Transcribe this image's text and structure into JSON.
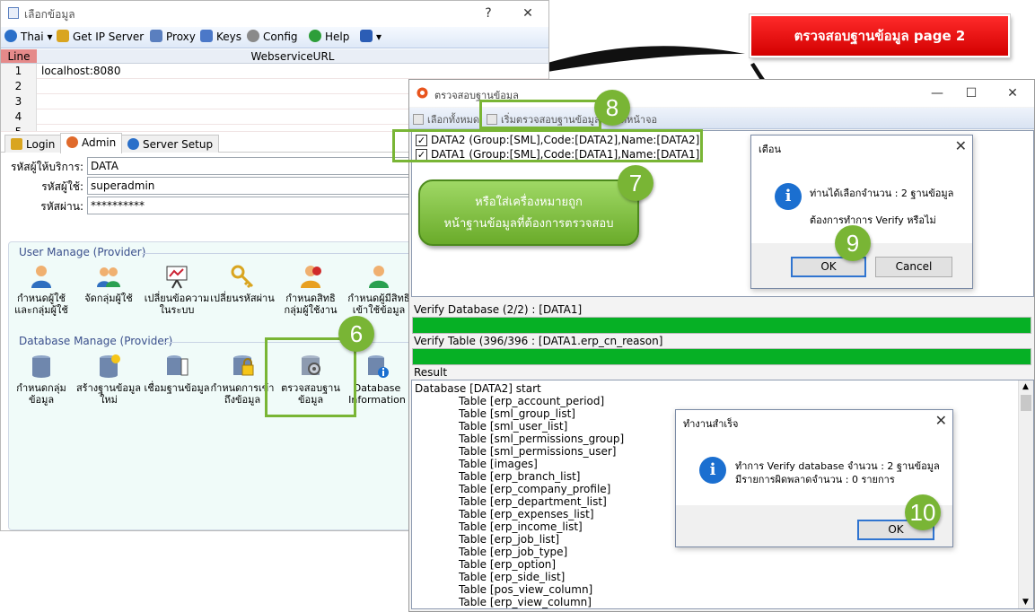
{
  "banner": {
    "text": "ตรวจสอบฐานข้อมูล page 2"
  },
  "win1": {
    "title": "เลือกข้อมูล",
    "help_glyph": "?",
    "close_glyph": "✕",
    "menu": [
      {
        "label": "Thai",
        "icon": "globe-icon",
        "color": "#2a6fc9"
      },
      {
        "label": "Get IP Server",
        "icon": "key-icon",
        "color": "#d9a520"
      },
      {
        "label": "Proxy",
        "icon": "proxy-icon",
        "color": "#5a7fbf"
      },
      {
        "label": "Keys",
        "icon": "users-icon",
        "color": "#4b78c8"
      },
      {
        "label": "Config",
        "icon": "gear-icon",
        "color": "#6a6a6a"
      },
      {
        "label": "Help",
        "icon": "help-icon",
        "color": "#2e9e3a"
      }
    ],
    "grid": {
      "col_line": "Line",
      "col_url": "WebserviceURL",
      "rows": [
        {
          "n": "1",
          "v": "localhost:8080"
        },
        {
          "n": "2",
          "v": ""
        },
        {
          "n": "3",
          "v": ""
        },
        {
          "n": "4",
          "v": ""
        },
        {
          "n": "5",
          "v": ""
        }
      ]
    },
    "tabs": [
      "Login",
      "Admin",
      "Server Setup"
    ],
    "fields": [
      {
        "label": "รหัสผู้ให้บริการ:",
        "value": "DATA"
      },
      {
        "label": "รหัสผู้ใช้:",
        "value": "superadmin"
      },
      {
        "label": "รหัสผ่าน:",
        "value": "**********"
      }
    ],
    "group_user": "User Manage (Provider)",
    "group_db": "Database Manage (Provider)",
    "user_icons": [
      {
        "l1": "กำหนดผู้ใช้",
        "l2": "และกลุ่มผู้ใช้",
        "icon": "user-icon"
      },
      {
        "l1": "จัดกลุ่มผู้ใช้",
        "l2": "",
        "icon": "user-group-icon"
      },
      {
        "l1": "เปลี่ยนข้อความ",
        "l2": "ในระบบ",
        "icon": "presentation-icon"
      },
      {
        "l1": "เปลี่ยนรหัสผ่าน",
        "l2": "",
        "icon": "keys-icon"
      },
      {
        "l1": "กำหนดสิทธิ",
        "l2": "กลุ่มผู้ใช้งาน",
        "icon": "group-permission-icon"
      },
      {
        "l1": "กำหนดผู้มีสิทธิ",
        "l2": "เข้าใช้ข้อมูล",
        "icon": "user-access-icon"
      }
    ],
    "db_icons": [
      {
        "l1": "กำหนดกลุ่ม",
        "l2": "ข้อมูล",
        "icon": "database-icon"
      },
      {
        "l1": "สร้างฐานข้อมูล",
        "l2": "ใหม่",
        "icon": "new-database-icon"
      },
      {
        "l1": "เชื่อมฐานข้อมูล",
        "l2": "",
        "icon": "connect-database-icon"
      },
      {
        "l1": "กำหนดการเข้า",
        "l2": "ถึงข้อมูล",
        "icon": "lock-database-icon"
      },
      {
        "l1": "ตรวจสอบฐาน",
        "l2": "ข้อมูล",
        "icon": "verify-database-icon"
      },
      {
        "l1": "Database",
        "l2": "Information",
        "icon": "database-info-icon"
      }
    ]
  },
  "win2": {
    "title": "ตรวจสอบฐานข้อมูล",
    "min_glyph": "—",
    "max_glyph": "☐",
    "close_glyph": "✕",
    "toolbar": [
      "เลือกทั้งหมด",
      "เริ่มตรวจสอบฐานข้อมูล",
      "ปิดหน้าจอ"
    ],
    "databases": [
      "DATA2 (Group:[SML],Code:[DATA2],Name:[DATA2]",
      "DATA1 (Group:[SML],Code:[DATA1],Name:[DATA1]"
    ],
    "verify_db": "Verify Database (2/2) : [DATA1]",
    "verify_db_progress": 1.0,
    "verify_table": "Verify Table (396/396 : [DATA1.erp_cn_reason]",
    "verify_table_progress": 1.0,
    "result_label": "Result",
    "result_lines": [
      "Database [DATA2] start",
      "Table [erp_account_period]",
      "Table [sml_group_list]",
      "Table [sml_user_list]",
      "Table [sml_permissions_group]",
      "Table [sml_permissions_user]",
      "Table [images]",
      "Table [erp_branch_list]",
      "Table [erp_company_profile]",
      "Table [erp_department_list]",
      "Table [erp_expenses_list]",
      "Table [erp_income_list]",
      "Table [erp_job_list]",
      "Table [erp_job_type]",
      "Table [erp_option]",
      "Table [erp_side_list]",
      "Table [pos_view_column]",
      "Table [erp_view_column]"
    ]
  },
  "dlg_confirm": {
    "title": "เตือน",
    "line1": "ท่านได้เลือกจำนวน : 2 ฐานข้อมูล",
    "line2": "ต้องการทำการ Verify หรือไม่",
    "ok": "OK",
    "cancel": "Cancel"
  },
  "dlg_done": {
    "title": "ทำงานสำเร็จ",
    "line1": "ทำการ Verify database จำนวน : 2 ฐานข้อมูล",
    "line2": "มีรายการผิดพลาดจำนวน : 0 รายการ",
    "ok": "OK"
  },
  "callout": {
    "line1": "หรือใส่เครื่องหมายถูก",
    "line2": "หน้าฐานข้อมูลที่ต้องการตรวจสอบ"
  },
  "steps": [
    "6",
    "7",
    "8",
    "9",
    "10"
  ],
  "colors": {
    "accent_green": "#79b535",
    "progress_green": "#06b025",
    "banner_red": "#e00000"
  }
}
